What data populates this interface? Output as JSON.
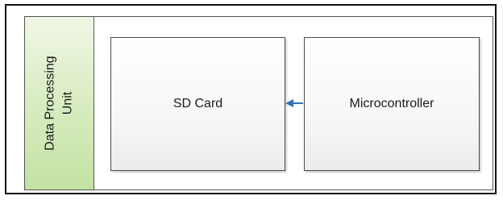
{
  "diagram": {
    "container": {
      "label": "Data Processing\nUnit"
    },
    "blocks": [
      {
        "id": "sd_card",
        "label": "SD Card"
      },
      {
        "id": "microcontroller",
        "label": "Microcontroller"
      }
    ],
    "connections": [
      {
        "from": "microcontroller",
        "to": "sd_card",
        "color": "#2e74b5"
      }
    ],
    "colors": {
      "container_band": "#d6ebbd",
      "arrow": "#2e74b5",
      "block_border": "#4a4a4a"
    }
  }
}
